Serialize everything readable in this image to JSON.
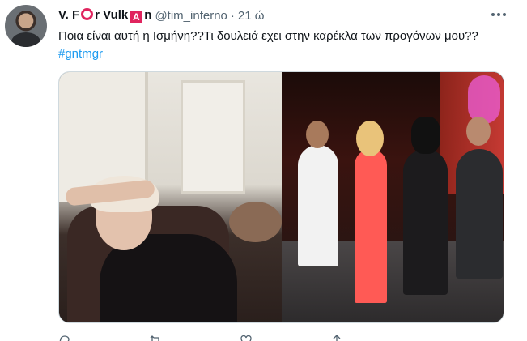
{
  "tweet": {
    "display_name_part1": "V. F",
    "display_name_part2": "r Vulk",
    "display_name_part3": "n",
    "handle": "@tim_inferno",
    "separator": "·",
    "time": "21 ώ",
    "text": "Ποια είναι αυτή η Ισμήνη??Τι δουλειά εχει στην καρέκλα των προγόνων μου??",
    "hashtag": "#gntmgr"
  },
  "icons": {
    "avatar": "avatar",
    "more": "more-icon",
    "reply": "reply-icon",
    "retweet": "retweet-icon",
    "like": "like-icon",
    "share": "share-icon"
  },
  "colors": {
    "link": "#1d9bf0",
    "secondary_text": "#536471",
    "emoji_red": "#e0245e"
  }
}
